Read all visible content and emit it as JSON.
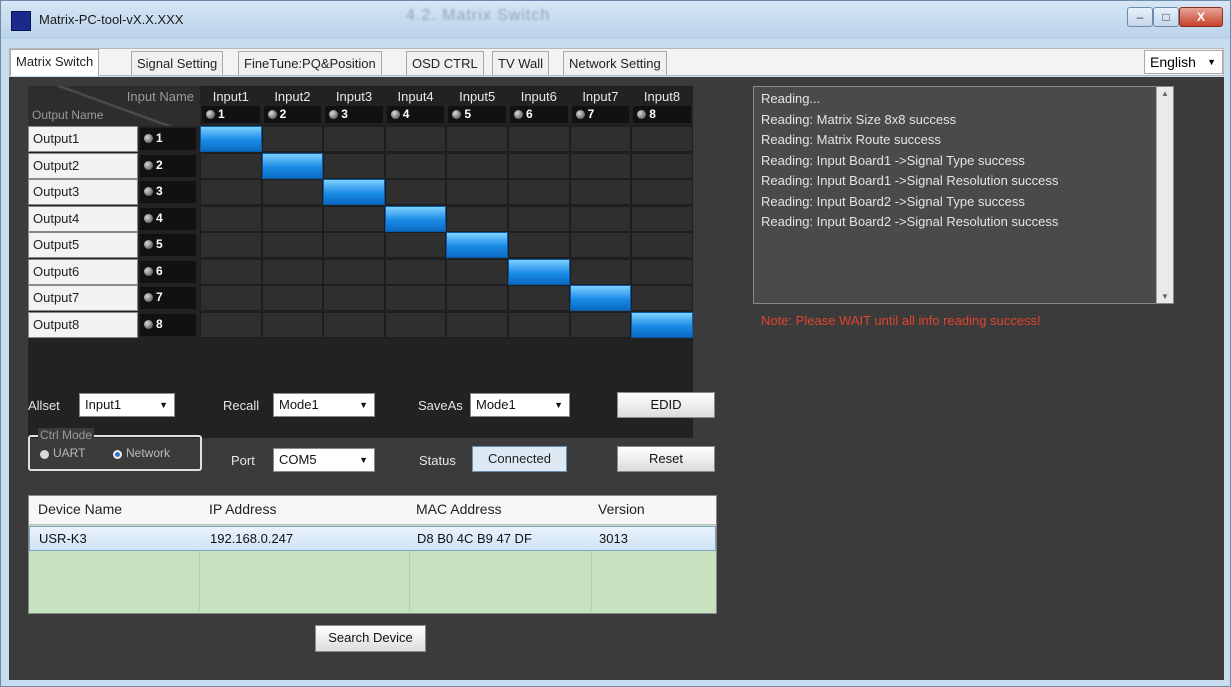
{
  "window": {
    "title": "Matrix-PC-tool-vX.X.XXX",
    "title_ghost": "4.2. Matrix Switch",
    "min": "–",
    "max": "□",
    "close": "X"
  },
  "tabs": [
    "Matrix Switch",
    "Signal Setting",
    "FineTune:PQ&Position",
    "OSD CTRL",
    "TV Wall",
    "Network Setting"
  ],
  "language": "English",
  "matrix": {
    "corner_input": "Input Name",
    "corner_output": "Output Name",
    "inputs": [
      {
        "name": "Input1",
        "num": "1"
      },
      {
        "name": "Input2",
        "num": "2"
      },
      {
        "name": "Input3",
        "num": "3"
      },
      {
        "name": "Input4",
        "num": "4"
      },
      {
        "name": "Input5",
        "num": "5"
      },
      {
        "name": "Input6",
        "num": "6"
      },
      {
        "name": "Input7",
        "num": "7"
      },
      {
        "name": "Input8",
        "num": "8"
      }
    ],
    "outputs": [
      {
        "name": "Output1",
        "num": "1"
      },
      {
        "name": "Output2",
        "num": "2"
      },
      {
        "name": "Output3",
        "num": "3"
      },
      {
        "name": "Output4",
        "num": "4"
      },
      {
        "name": "Output5",
        "num": "5"
      },
      {
        "name": "Output6",
        "num": "6"
      },
      {
        "name": "Output7",
        "num": "7"
      },
      {
        "name": "Output8",
        "num": "8"
      }
    ],
    "routes": [
      1,
      2,
      3,
      4,
      5,
      6,
      7,
      8
    ]
  },
  "controls": {
    "allset_label": "Allset",
    "allset_value": "Input1",
    "recall_label": "Recall",
    "recall_value": "Mode1",
    "saveas_label": "SaveAs",
    "saveas_value": "Mode1",
    "edid_button": "EDID",
    "ctrl_mode_legend": "Ctrl Mode",
    "uart_label": "UART",
    "network_label": "Network",
    "ctrl_mode_selected": "Network",
    "port_label": "Port",
    "port_value": "COM5",
    "status_label": "Status",
    "status_value": "Connected",
    "reset_button": "Reset",
    "search_button": "Search Device"
  },
  "device_table": {
    "headers": [
      "Device Name",
      "IP Address",
      "MAC Address",
      "Version"
    ],
    "rows": [
      [
        "USR-K3",
        "192.168.0.247",
        "D8 B0 4C B9 47 DF",
        "3013"
      ]
    ]
  },
  "log": [
    "Reading...",
    "Reading: Matrix Size 8x8 success",
    "Reading: Matrix Route success",
    "Reading: Input Board1 ->Signal Type success",
    "Reading: Input Board1 ->Signal Resolution success",
    "Reading: Input Board2 ->Signal Type success",
    "Reading: Input Board2 ->Signal Resolution success"
  ],
  "note": "Note: Please WAIT until all info reading success!",
  "colors": {
    "route_on": "#1a8be6",
    "note": "#e0432f",
    "panel": "#3b3b3b"
  }
}
